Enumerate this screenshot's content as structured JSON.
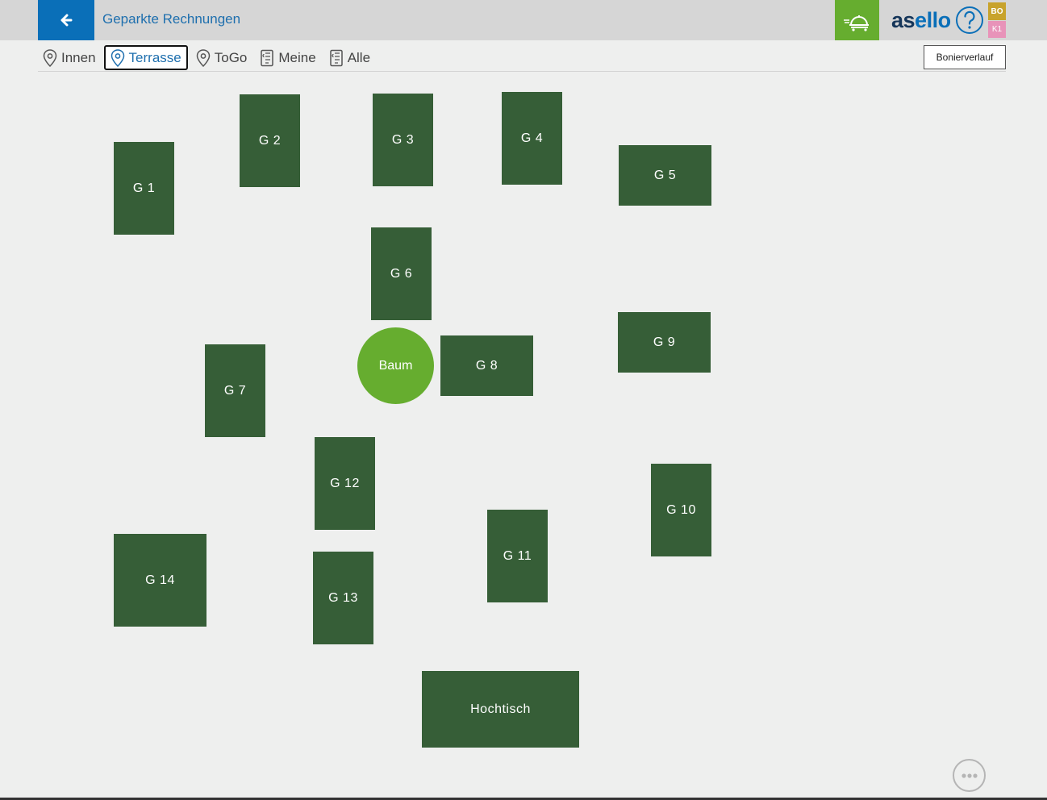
{
  "header": {
    "title": "Geparkte Rechnungen",
    "logo_part1": "as",
    "logo_part2": "ello",
    "badge_bo": "BO",
    "badge_k1": "K1"
  },
  "tabs": [
    {
      "label": "Innen",
      "icon": "location-pin-icon",
      "active": false
    },
    {
      "label": "Terrasse",
      "icon": "location-pin-icon",
      "active": true
    },
    {
      "label": "ToGo",
      "icon": "location-pin-icon",
      "active": false
    },
    {
      "label": "Meine",
      "icon": "receipt-icon",
      "active": false
    },
    {
      "label": "Alle",
      "icon": "receipt-icon",
      "active": false
    }
  ],
  "history_button": "Bonierverlauf",
  "tables": [
    {
      "id": "g1",
      "label": "G 1"
    },
    {
      "id": "g2",
      "label": "G 2"
    },
    {
      "id": "g3",
      "label": "G 3"
    },
    {
      "id": "g4",
      "label": "G 4"
    },
    {
      "id": "g5",
      "label": "G 5"
    },
    {
      "id": "g6",
      "label": "G 6"
    },
    {
      "id": "g7",
      "label": "G 7"
    },
    {
      "id": "g8",
      "label": "G 8"
    },
    {
      "id": "g9",
      "label": "G 9"
    },
    {
      "id": "g10",
      "label": "G 10"
    },
    {
      "id": "g11",
      "label": "G 11"
    },
    {
      "id": "g12",
      "label": "G 12"
    },
    {
      "id": "g13",
      "label": "G 13"
    },
    {
      "id": "g14",
      "label": "G 14"
    },
    {
      "id": "hochtisch",
      "label": "Hochtisch"
    }
  ],
  "tree_label": "Baum",
  "colors": {
    "table": "#365e37",
    "tree": "#66ad2f",
    "accent": "#0a6fb8"
  }
}
